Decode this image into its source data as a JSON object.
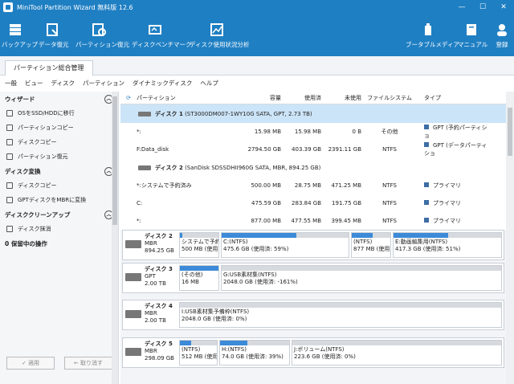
{
  "window": {
    "title": "MiniTool Partition Wizard 無料版 12.6"
  },
  "ribbon": {
    "backup": "バックアップ",
    "data_recovery": "データ復元",
    "partition_recovery": "パーティション復元",
    "benchmark": "ディスクベンチマーク",
    "space_analyzer": "ディスク使用状況分析",
    "bootable_media": "ブータブルメディア",
    "manual": "マニュアル",
    "register": "登録"
  },
  "tabs": {
    "partition_management": "パーティション総合管理"
  },
  "menu": [
    "一般",
    "ビュー",
    "ディスク",
    "パーティション",
    "ダイナミックディスク",
    "ヘルプ"
  ],
  "sidebar": {
    "wizard": {
      "title": "ウィザード",
      "items": [
        "OSをSSD/HDDに移行",
        "パーティションコピー",
        "ディスクコピー",
        "パーティション復元"
      ]
    },
    "disk_convert": {
      "title": "ディスク変換",
      "items": [
        "ディスクコピー",
        "GPTディスクをMBRに変換"
      ]
    },
    "disk_cleanup": {
      "title": "ディスククリーンアップ",
      "items": [
        "ディスク抹消"
      ]
    },
    "pending": "0 保留中の操作",
    "apply": "✓ 適用",
    "undo": "← 取り消す"
  },
  "columns": {
    "partition": "パーティション",
    "capacity": "容量",
    "used": "使用済",
    "unused": "未使用",
    "fs": "ファイルシステム",
    "type": "タイプ"
  },
  "list": {
    "disk1": "ディスク 1",
    "disk1_detail": "(ST3000DM007-1WY10G SATA, GPT, 2.73 TB)",
    "disk1_rows": [
      {
        "name": "*:",
        "cap": "15.98 MB",
        "used": "15.98 MB",
        "unused": "0 B",
        "fs": "その他",
        "type": "GPT (予約パーティショ"
      },
      {
        "name": "F:Data_disk",
        "cap": "2794.50 GB",
        "used": "403.39 GB",
        "unused": "2391.11 GB",
        "fs": "NTFS",
        "type": "GPT (データパーティショ"
      }
    ],
    "disk2": "ディスク 2",
    "disk2_detail": "(SanDisk SDSSDHII960G SATA, MBR, 894.25 GB)",
    "disk2_rows": [
      {
        "name": "*:システムで予約済み",
        "cap": "500.00 MB",
        "used": "28.75 MB",
        "unused": "471.25 MB",
        "fs": "NTFS",
        "type": "プライマリ"
      },
      {
        "name": "C:",
        "cap": "475.59 GB",
        "used": "283.84 GB",
        "unused": "191.75 GB",
        "fs": "NTFS",
        "type": "プライマリ"
      },
      {
        "name": "*:",
        "cap": "877.00 MB",
        "used": "477.55 MB",
        "unused": "399.45 MB",
        "fs": "NTFS",
        "type": "プライマリ"
      }
    ]
  },
  "map": {
    "disk2": {
      "name": "ディスク 2",
      "style": "MBR",
      "size": "894.25 GB",
      "parts": [
        {
          "l1": "システムで予約",
          "l2": "500 MB (使用",
          "fill": 0.06
        },
        {
          "l1": "C:(NTFS)",
          "l2": "475.6 GB (使用済: 59%)",
          "fill": 0.59
        },
        {
          "l1": "(NTFS)",
          "l2": "877 MB (使用",
          "fill": 0.54
        },
        {
          "l1": "E:動画編集用(NTFS)",
          "l2": "417.3 GB (使用済: 51%)",
          "fill": 0.51
        }
      ]
    },
    "disk3": {
      "name": "ディスク 3",
      "style": "GPT",
      "size": "2.00 TB",
      "parts": [
        {
          "l1": "(その他)",
          "l2": "16 MB",
          "fill": 1.0
        },
        {
          "l1": "G:USB素材集(NTFS)",
          "l2": "2048.0 GB (使用済: -161%)",
          "fill": 0.0
        }
      ]
    },
    "disk4": {
      "name": "ディスク 4",
      "style": "MBR",
      "size": "2.00 TB",
      "parts": [
        {
          "l1": "I:USB素材集予備枠(NTFS)",
          "l2": "2048.0 GB (使用済: 0%)",
          "fill": 0.0
        }
      ]
    },
    "disk5": {
      "name": "ディスク 5",
      "style": "MBR",
      "size": "298.09 GB",
      "parts": [
        {
          "l1": "(NTFS)",
          "l2": "512 MB (使用",
          "fill": 0.3
        },
        {
          "l1": "H:(NTFS)",
          "l2": "74.0 GB (使用済: 39%)",
          "fill": 0.39
        },
        {
          "l1": "J:ボリューム(NTFS)",
          "l2": "223.6 GB (使用済: 0%)",
          "fill": 0.0
        }
      ]
    }
  }
}
